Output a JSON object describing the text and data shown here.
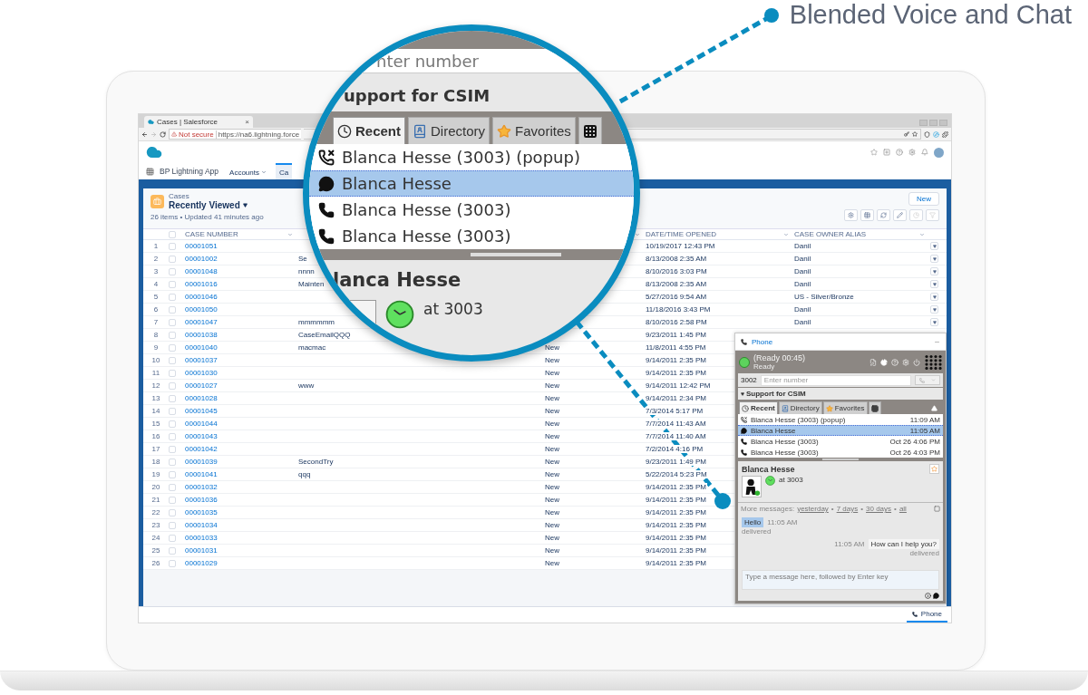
{
  "callout": {
    "label": "Blended Voice and Chat"
  },
  "browser": {
    "tab_title": "Cases | Salesforce",
    "tab_close": "×",
    "security": "Not secure",
    "url": "https://na6.lightning.force"
  },
  "app": {
    "name": "BP Lightning App",
    "nav": [
      {
        "label": "Accounts",
        "selected": false
      },
      {
        "label": "Ca",
        "selected": true
      }
    ]
  },
  "list_view": {
    "object": "Cases",
    "title": "Recently Viewed",
    "summary": "26 items • Updated 41 minutes ago",
    "new_button": "New",
    "toolbar": [
      {
        "kind": "settings",
        "disabled": false
      },
      {
        "kind": "table",
        "disabled": false
      },
      {
        "kind": "refresh",
        "disabled": false
      },
      {
        "kind": "edit",
        "disabled": false
      },
      {
        "kind": "chart",
        "disabled": true
      },
      {
        "kind": "filter",
        "disabled": true
      }
    ]
  },
  "table": {
    "select_all": {
      "checked": false
    },
    "columns": [
      {
        "label": "CASE NUMBER"
      },
      {
        "label": "DATE/TIME OPENED"
      },
      {
        "label": "CASE OWNER ALIAS"
      }
    ],
    "rows": [
      {
        "index": "1",
        "checked": false,
        "case_number": "00001051",
        "opened": "10/19/2017 12:43 PM",
        "owner": "Danil",
        "menu": true
      },
      {
        "index": "2",
        "checked": false,
        "case_number": "00001002",
        "subject": "Se",
        "opened": "8/13/2008 2:35 AM",
        "owner": "Danil",
        "menu": true
      },
      {
        "index": "3",
        "checked": false,
        "case_number": "00001048",
        "subject": "nnnn",
        "opened": "8/10/2016 3:03 PM",
        "owner": "Danil",
        "menu": true
      },
      {
        "index": "4",
        "checked": false,
        "case_number": "00001016",
        "subject": "Mainten",
        "opened": "8/13/2008 2:35 AM",
        "owner": "Danil",
        "menu": true
      },
      {
        "index": "5",
        "checked": false,
        "case_number": "00001046",
        "opened": "5/27/2016 9:54 AM",
        "owner": "US - Silver/Bronze",
        "menu": true
      },
      {
        "index": "6",
        "checked": false,
        "case_number": "00001050",
        "opened": "11/18/2016 3:43 PM",
        "owner": "Danil",
        "menu": true
      },
      {
        "index": "7",
        "checked": false,
        "case_number": "00001047",
        "subject": "mmmmmm",
        "opened": "8/10/2016 2:58 PM",
        "owner": "Danil",
        "menu": true
      },
      {
        "index": "8",
        "checked": false,
        "case_number": "00001038",
        "subject": "CaseEmailQQQ",
        "opened": "9/23/2011 1:45 PM",
        "menu": false
      },
      {
        "index": "9",
        "checked": false,
        "case_number": "00001040",
        "subject": "macmac",
        "status": "New",
        "opened": "11/8/2011 4:55 PM",
        "menu": false
      },
      {
        "index": "10",
        "checked": false,
        "case_number": "00001037",
        "status": "New",
        "opened": "9/14/2011 2:35 PM",
        "menu": false
      },
      {
        "index": "11",
        "checked": false,
        "case_number": "00001030",
        "status": "New",
        "opened": "9/14/2011 2:35 PM",
        "menu": false
      },
      {
        "index": "12",
        "checked": false,
        "case_number": "00001027",
        "subject": "www",
        "status": "New",
        "opened": "9/14/2011 12:42 PM",
        "menu": false
      },
      {
        "index": "13",
        "checked": false,
        "case_number": "00001028",
        "status": "New",
        "opened": "9/14/2011 2:34 PM",
        "menu": false
      },
      {
        "index": "14",
        "checked": false,
        "case_number": "00001045",
        "status": "New",
        "opened": "7/3/2014 5:17 PM",
        "menu": false
      },
      {
        "index": "15",
        "checked": false,
        "case_number": "00001044",
        "status": "New",
        "opened": "7/7/2014 11:43 AM",
        "menu": false
      },
      {
        "index": "16",
        "checked": false,
        "case_number": "00001043",
        "status": "New",
        "opened": "7/7/2014 11:40 AM",
        "menu": false
      },
      {
        "index": "17",
        "checked": false,
        "case_number": "00001042",
        "status": "New",
        "opened": "7/2/2014 4:16 PM",
        "menu": false
      },
      {
        "index": "18",
        "checked": false,
        "case_number": "00001039",
        "subject": "SecondTry",
        "status": "New",
        "opened": "9/23/2011 1:49 PM",
        "menu": false
      },
      {
        "index": "19",
        "checked": false,
        "case_number": "00001041",
        "subject": "qqq",
        "status": "New",
        "opened": "5/22/2014 5:23 PM",
        "menu": false
      },
      {
        "index": "20",
        "checked": false,
        "case_number": "00001032",
        "status": "New",
        "opened": "9/14/2011 2:35 PM",
        "menu": false
      },
      {
        "index": "21",
        "checked": false,
        "case_number": "00001036",
        "status": "New",
        "opened": "9/14/2011 2:35 PM",
        "menu": false
      },
      {
        "index": "22",
        "checked": false,
        "case_number": "00001035",
        "status": "New",
        "opened": "9/14/2011 2:35 PM",
        "menu": false
      },
      {
        "index": "23",
        "checked": false,
        "case_number": "00001034",
        "status": "New",
        "opened": "9/14/2011 2:35 PM",
        "menu": false
      },
      {
        "index": "24",
        "checked": false,
        "case_number": "00001033",
        "status": "New",
        "opened": "9/14/2011 2:35 PM",
        "menu": false
      },
      {
        "index": "25",
        "checked": false,
        "case_number": "00001031",
        "status": "New",
        "opened": "9/14/2011 2:35 PM",
        "menu": false
      },
      {
        "index": "26",
        "checked": false,
        "case_number": "00001029",
        "status": "New",
        "opened": "9/14/2011 2:35 PM",
        "menu": false
      }
    ]
  },
  "utility_bar": {
    "phone_tab": "Phone"
  },
  "phone": {
    "title": "Phone",
    "status_title": "(Ready 00:45)",
    "status": "Ready",
    "extension": "3002",
    "number_placeholder": "Enter number",
    "group": "Support for CSIM",
    "tabs": [
      {
        "label": "Recent",
        "kind": "recent",
        "selected": true
      },
      {
        "label": "Directory",
        "kind": "directory",
        "selected": false
      },
      {
        "label": "Favorites",
        "kind": "favorites",
        "selected": false
      },
      {
        "kind": "dialpad",
        "selected": false
      }
    ],
    "recent": [
      {
        "kind": "missed",
        "name": "Blanca Hesse (3003) (popup)",
        "time": "11:09 AM",
        "selected": false
      },
      {
        "kind": "chat",
        "name": "Blanca Hesse",
        "time": "11:05 AM",
        "selected": true
      },
      {
        "kind": "call",
        "name": "Blanca Hesse (3003)",
        "time": "Oct 26 4:06 PM",
        "selected": false
      },
      {
        "kind": "call",
        "name": "Blanca Hesse (3003)",
        "time": "Oct 26 4:03 PM",
        "selected": false
      }
    ],
    "contact": {
      "name": "Blanca Hesse",
      "location": "at 3003"
    },
    "history": {
      "label": "More messages:",
      "links": [
        "yesterday",
        "7 days",
        "30 days",
        "all"
      ],
      "separators": [
        "•",
        "•",
        "•"
      ]
    },
    "messages": [
      {
        "kind": "incoming",
        "text": "Hello",
        "time": "11:05 AM",
        "status": "delivered"
      },
      {
        "kind": "outgoing",
        "text": "How can I help you?",
        "time": "11:05 AM",
        "status": "delivered"
      }
    ],
    "message_placeholder": "Type a message here, followed by Enter key"
  },
  "magnifier": {
    "number_placeholder": "nter number",
    "group": "upport for CSIM",
    "tabs": [
      {
        "label": "Recent",
        "kind": "recent",
        "selected": true
      },
      {
        "label": "Directory",
        "kind": "directory",
        "selected": false
      },
      {
        "label": "Favorites",
        "kind": "favorites",
        "selected": false
      },
      {
        "kind": "dialpad",
        "selected": false
      }
    ],
    "recent": [
      {
        "kind": "missed",
        "name": "Blanca Hesse (3003) (popup)",
        "selected": false
      },
      {
        "kind": "chat",
        "name": "Blanca Hesse",
        "selected": true
      },
      {
        "kind": "call",
        "name": "Blanca Hesse (3003)",
        "selected": false
      },
      {
        "kind": "call",
        "name": "Blanca Hesse (3003)",
        "selected": false
      }
    ],
    "contact": {
      "name": "lanca Hesse",
      "location": "at 3003"
    }
  }
}
